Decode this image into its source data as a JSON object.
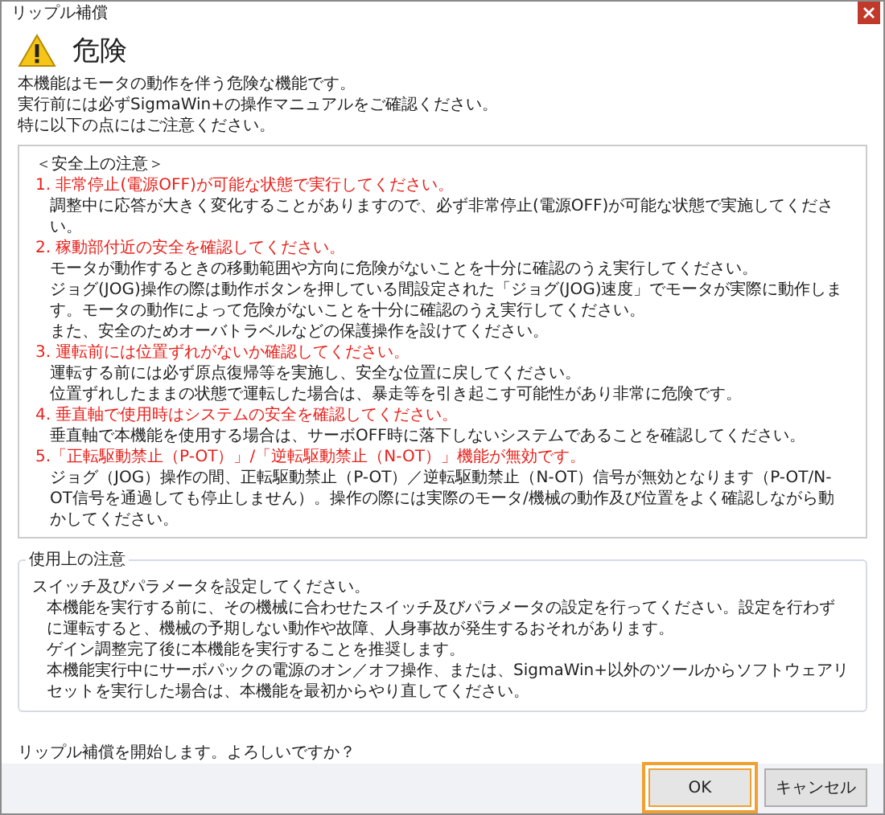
{
  "window": {
    "title": "リップル補償"
  },
  "header": {
    "title": "危険",
    "lines": [
      "本機能はモータの動作を伴う危険な機能です。",
      "実行前には必ずSigmaWin+の操作マニュアルをご確認ください。",
      "特に以下の点にはご注意ください。"
    ]
  },
  "safety": {
    "heading": "＜安全上の注意＞",
    "lines": [
      {
        "kind": "warning",
        "text": "1. 非常停止(電源OFF)が可能な状態で実行してください。"
      },
      {
        "kind": "detail",
        "text": "調整中に応答が大きく変化することがありますので、必ず非常停止(電源OFF)が可能な状態で実施してください。"
      },
      {
        "kind": "warning",
        "text": "2. 稼動部付近の安全を確認してください。"
      },
      {
        "kind": "detail",
        "text": "モータが動作するときの移動範囲や方向に危険がないことを十分に確認のうえ実行してください。"
      },
      {
        "kind": "detail",
        "text": "ジョグ(JOG)操作の際は動作ボタンを押している間設定された「ジョグ(JOG)速度」でモータが実際に動作します。モータの動作によって危険がないことを十分に確認のうえ実行してください。"
      },
      {
        "kind": "detail",
        "text": "また、安全のためオーバトラベルなどの保護操作を設けてください。"
      },
      {
        "kind": "warning",
        "text": "3. 運転前には位置ずれがないか確認してください。"
      },
      {
        "kind": "detail",
        "text": "運転する前には必ず原点復帰等を実施し、安全な位置に戻してください。"
      },
      {
        "kind": "detail",
        "text": "位置ずれしたままの状態で運転した場合は、暴走等を引き起こす可能性があり非常に危険です。"
      },
      {
        "kind": "warning",
        "text": "4. 垂直軸で使用時はシステムの安全を確認してください。"
      },
      {
        "kind": "detail",
        "text": "垂直軸で本機能を使用する場合は、サーボOFF時に落下しないシステムであることを確認してください。"
      },
      {
        "kind": "warning",
        "text": "5.「正転駆動禁止（P-OT）」/「逆転駆動禁止（N-OT）」機能が無効です。"
      },
      {
        "kind": "detail",
        "text": "ジョグ（JOG）操作の間、正転駆動禁止（P-OT）／逆転駆動禁止（N-OT）信号が無効となります（P-OT/N-OT信号を通過しても停止しません）。操作の際には実際のモータ/機械の動作及び位置をよく確認しながら動かしてください。"
      }
    ]
  },
  "usage": {
    "legend": "使用上の注意",
    "lines": [
      {
        "kind": "lead",
        "text": "スイッチ及びパラメータを設定してください。"
      },
      {
        "kind": "detail",
        "text": "本機能を実行する前に、その機械に合わせたスイッチ及びパラメータの設定を行ってください。設定を行わずに運転すると、機械の予期しない動作や故障、人身事故が発生するおそれがあります。"
      },
      {
        "kind": "detail",
        "text": "ゲイン調整完了後に本機能を実行することを推奨します。"
      },
      {
        "kind": "detail",
        "text": "本機能実行中にサーボパックの電源のオン／オフ操作、または、SigmaWin+以外のツールからソフトウェアリセットを実行した場合は、本機能を最初からやり直してください。"
      }
    ]
  },
  "question": "リップル補償を開始します。よろしいですか？",
  "buttons": [
    {
      "label": "OK",
      "selected": true
    },
    {
      "label": "キャンセル",
      "selected": false
    }
  ]
}
